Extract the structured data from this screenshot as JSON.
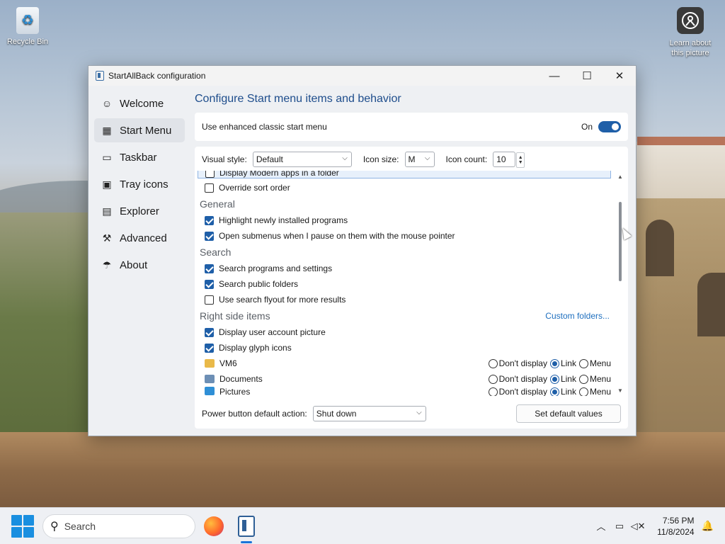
{
  "desktop": {
    "recycle_bin": "Recycle Bin",
    "learn_line1": "Learn about",
    "learn_line2": "this picture"
  },
  "window": {
    "title": "StartAllBack configuration",
    "controls": {
      "minimize": "—",
      "maximize": "☐",
      "close": "✕"
    }
  },
  "sidebar": {
    "items": [
      {
        "label": "Welcome",
        "icon": "smile-icon",
        "glyph": "☺"
      },
      {
        "label": "Start Menu",
        "icon": "start-menu-icon",
        "glyph": "▦"
      },
      {
        "label": "Taskbar",
        "icon": "taskbar-icon",
        "glyph": "▭"
      },
      {
        "label": "Tray icons",
        "icon": "tray-icon",
        "glyph": "▣"
      },
      {
        "label": "Explorer",
        "icon": "folder-icon",
        "glyph": "▤"
      },
      {
        "label": "Advanced",
        "icon": "wrench-icon",
        "glyph": "⚒"
      },
      {
        "label": "About",
        "icon": "about-icon",
        "glyph": "☂"
      }
    ],
    "active": "Start Menu"
  },
  "main": {
    "title": "Configure Start menu items and behavior",
    "enhanced": {
      "label": "Use enhanced classic start menu",
      "state": "On"
    },
    "options": {
      "visual_style_label": "Visual style:",
      "visual_style_value": "Default",
      "icon_size_label": "Icon size:",
      "icon_size_value": "M",
      "icon_count_label": "Icon count:",
      "icon_count_value": "10"
    },
    "list": {
      "top_items": [
        {
          "label": "Display Modern apps in a folder",
          "checked": false,
          "selected": true
        },
        {
          "label": "Override sort order",
          "checked": false
        }
      ],
      "general": {
        "header": "General",
        "items": [
          {
            "label": "Highlight newly installed programs",
            "checked": true
          },
          {
            "label": "Open submenus when I pause on them with the mouse pointer",
            "checked": true
          }
        ]
      },
      "search": {
        "header": "Search",
        "items": [
          {
            "label": "Search programs and settings",
            "checked": true
          },
          {
            "label": "Search public folders",
            "checked": true
          },
          {
            "label": "Use search flyout for more results",
            "checked": false
          }
        ]
      },
      "right_side": {
        "header": "Right side items",
        "link": "Custom folders...",
        "items": [
          {
            "label": "Display user account picture",
            "checked": true
          },
          {
            "label": "Display glyph icons",
            "checked": true
          }
        ],
        "folders": [
          {
            "label": "VM6",
            "icon_color": "#e9b949"
          },
          {
            "label": "Documents",
            "icon_color": "#6d8fb5"
          },
          {
            "label": "Pictures",
            "icon_color": "#2f8fd6"
          }
        ],
        "radio_labels": {
          "dont": "Don't display",
          "link": "Link",
          "menu": "Menu"
        },
        "selected_radio": "Link"
      }
    },
    "power": {
      "label": "Power button default action:",
      "value": "Shut down"
    },
    "default_button": "Set default values"
  },
  "taskbar": {
    "search_placeholder": "Search",
    "time": "7:56 PM",
    "date": "11/8/2024",
    "accent": "#1a73d9"
  }
}
